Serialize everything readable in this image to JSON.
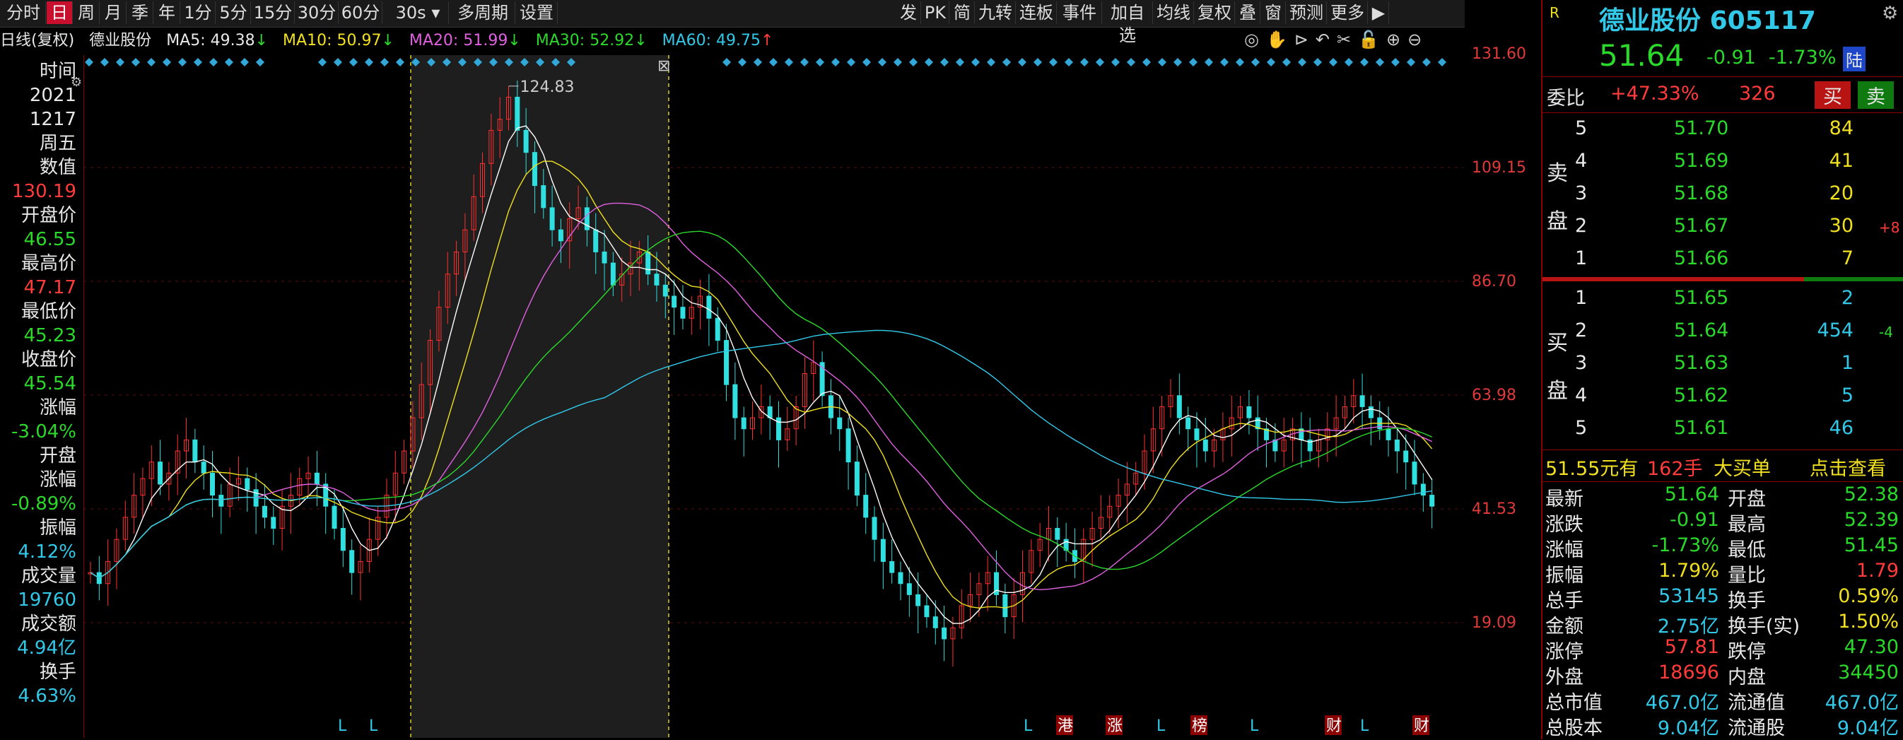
{
  "toolbar": {
    "periods": [
      "分时",
      "日",
      "周",
      "月",
      "季",
      "年",
      "1分",
      "5分",
      "15分",
      "30分",
      "60分"
    ],
    "selected": "日",
    "interval_value": "30s",
    "multi_period": "多周期",
    "settings": "设置",
    "right_buttons": [
      "发",
      "PK",
      "简",
      "九转",
      "连板",
      "事件",
      "加自选",
      "均线",
      "复权",
      "叠",
      "窗",
      "预测",
      "更多"
    ]
  },
  "infobar": {
    "mode": "日线(复权)",
    "stock": "德业股份",
    "ma5": "MA5: 49.38",
    "ma5_arrow": "↓",
    "ma10": "MA10: 50.97",
    "ma10_arrow": "↓",
    "ma20": "MA20: 51.99",
    "ma20_arrow": "↓",
    "ma30": "MA30: 52.92",
    "ma30_arrow": "↓",
    "ma60": "MA60: 49.75",
    "ma60_arrow": "↑"
  },
  "left_col": [
    {
      "t": "时间",
      "c": "wht"
    },
    {
      "t": "2021",
      "c": "wht"
    },
    {
      "t": "1217",
      "c": "wht"
    },
    {
      "t": "周五",
      "c": "wht"
    },
    {
      "t": "数值",
      "c": "wht"
    },
    {
      "t": "130.19",
      "c": "red"
    },
    {
      "t": "开盘价",
      "c": "wht"
    },
    {
      "t": "46.55",
      "c": "grn"
    },
    {
      "t": "最高价",
      "c": "wht"
    },
    {
      "t": "47.17",
      "c": "red"
    },
    {
      "t": "最低价",
      "c": "wht"
    },
    {
      "t": "45.23",
      "c": "grn"
    },
    {
      "t": "收盘价",
      "c": "wht"
    },
    {
      "t": "45.54",
      "c": "grn"
    },
    {
      "t": "涨幅",
      "c": "wht"
    },
    {
      "t": "-3.04%",
      "c": "grn"
    },
    {
      "t": "开盘",
      "c": "wht"
    },
    {
      "t": "涨幅",
      "c": "wht"
    },
    {
      "t": "-0.89%",
      "c": "grn"
    },
    {
      "t": "振幅",
      "c": "wht"
    },
    {
      "t": "4.12%",
      "c": "cyn"
    },
    {
      "t": "成交量",
      "c": "wht"
    },
    {
      "t": "19760",
      "c": "cyn"
    },
    {
      "t": "成交额",
      "c": "wht"
    },
    {
      "t": "4.94亿",
      "c": "cyn"
    },
    {
      "t": "换手",
      "c": "wht"
    },
    {
      "t": "4.63%",
      "c": "cyn"
    }
  ],
  "y_axis": [
    "131.60",
    "109.15",
    "86.70",
    "63.98",
    "41.53",
    "19.09"
  ],
  "max_label": "124.83",
  "bottom_markers": [
    "L",
    "L",
    "L",
    "港",
    "涨",
    "L",
    "榜",
    "L",
    "财",
    "L",
    "财"
  ],
  "chart_data": {
    "type": "candlestick",
    "ma_colors": {
      "MA5": "#ffffff",
      "MA10": "#f0e020",
      "MA20": "#e060e0",
      "MA30": "#2bd92b",
      "MA60": "#32c8e8"
    },
    "ylim": [
      19.09,
      131.6
    ],
    "close_series": [
      38,
      36,
      40,
      44,
      48,
      52,
      55,
      58,
      54,
      56,
      60,
      62,
      58,
      56,
      52,
      50,
      54,
      55,
      53,
      50,
      48,
      46,
      50,
      52,
      55,
      56,
      54,
      50,
      46,
      42,
      38,
      40,
      44,
      48,
      52,
      56,
      60,
      66,
      72,
      80,
      86,
      92,
      96,
      100,
      106,
      112,
      118,
      120,
      124,
      118,
      114,
      108,
      104,
      100,
      98,
      102,
      104,
      100,
      96,
      94,
      90,
      92,
      94,
      96,
      92,
      90,
      88,
      86,
      84,
      86,
      88,
      84,
      80,
      72,
      66,
      64,
      66,
      68,
      66,
      62,
      64,
      68,
      74,
      76,
      70,
      66,
      64,
      58,
      52,
      48,
      44,
      40,
      38,
      36,
      34,
      32,
      30,
      28,
      26,
      28,
      32,
      34,
      36,
      38,
      34,
      30,
      34,
      38,
      42,
      44,
      46,
      44,
      42,
      40,
      44,
      46,
      48,
      50,
      52,
      54,
      56,
      60,
      64,
      68,
      70,
      66,
      64,
      62,
      60,
      62,
      64,
      66,
      68,
      66,
      64,
      62,
      60,
      62,
      64,
      62,
      60,
      62,
      64,
      66,
      68,
      70,
      68,
      66,
      64,
      62,
      60,
      58,
      54,
      52,
      50
    ]
  },
  "right": {
    "name": "德业股份",
    "code": "605117",
    "price": "51.64",
    "change": "-0.91",
    "change_pct": "-1.73%",
    "badge": "陆",
    "weibi_label": "委比",
    "weibi_value": "+47.33%",
    "weibi_num": "326",
    "buy_btn": "买",
    "sell_btn": "卖",
    "sell_side_label": [
      "卖",
      "盘"
    ],
    "buy_side_label": [
      "买",
      "盘"
    ],
    "asks": [
      {
        "lvl": "5",
        "price": "51.70",
        "vol": "84",
        "chg": ""
      },
      {
        "lvl": "4",
        "price": "51.69",
        "vol": "41",
        "chg": ""
      },
      {
        "lvl": "3",
        "price": "51.68",
        "vol": "20",
        "chg": ""
      },
      {
        "lvl": "2",
        "price": "51.67",
        "vol": "30",
        "chg": "+8"
      },
      {
        "lvl": "1",
        "price": "51.66",
        "vol": "7",
        "chg": ""
      }
    ],
    "bids": [
      {
        "lvl": "1",
        "price": "51.65",
        "vol": "2",
        "chg": ""
      },
      {
        "lvl": "2",
        "price": "51.64",
        "vol": "454",
        "chg": "-4"
      },
      {
        "lvl": "3",
        "price": "51.63",
        "vol": "1",
        "chg": ""
      },
      {
        "lvl": "4",
        "price": "51.62",
        "vol": "5",
        "chg": ""
      },
      {
        "lvl": "5",
        "price": "51.61",
        "vol": "46",
        "chg": ""
      }
    ],
    "big_order_price": "51.55元有",
    "big_order_vol": "162手",
    "big_order_label": "大买单",
    "big_order_link": "点击查看",
    "stats": [
      {
        "l": "最新",
        "v": "51.64",
        "vc": "grn",
        "l2": "开盘",
        "v2": "52.38",
        "v2c": "grn"
      },
      {
        "l": "涨跌",
        "v": "-0.91",
        "vc": "grn",
        "l2": "最高",
        "v2": "52.39",
        "v2c": "grn"
      },
      {
        "l": "涨幅",
        "v": "-1.73%",
        "vc": "grn",
        "l2": "最低",
        "v2": "51.45",
        "v2c": "grn"
      },
      {
        "l": "振幅",
        "v": "1.79%",
        "vc": "yel",
        "l2": "量比",
        "v2": "1.79",
        "v2c": "red"
      },
      {
        "l": "总手",
        "v": "53145",
        "vc": "cyn",
        "l2": "换手",
        "v2": "0.59%",
        "v2c": "yel"
      },
      {
        "l": "金额",
        "v": "2.75亿",
        "vc": "cyn",
        "l2": "换手(实)",
        "v2": "1.50%",
        "v2c": "yel"
      },
      {
        "l": "涨停",
        "v": "57.81",
        "vc": "red",
        "l2": "跌停",
        "v2": "47.30",
        "v2c": "grn"
      },
      {
        "l": "外盘",
        "v": "18696",
        "vc": "red",
        "l2": "内盘",
        "v2": "34450",
        "v2c": "grn"
      },
      {
        "l": "总市值",
        "v": "467.0亿",
        "vc": "cyn",
        "l2": "流通值",
        "v2": "467.0亿",
        "v2c": "cyn"
      },
      {
        "l": "总股本",
        "v": "9.04亿",
        "vc": "cyn",
        "l2": "流通股",
        "v2": "9.04亿",
        "v2c": "cyn"
      }
    ]
  }
}
